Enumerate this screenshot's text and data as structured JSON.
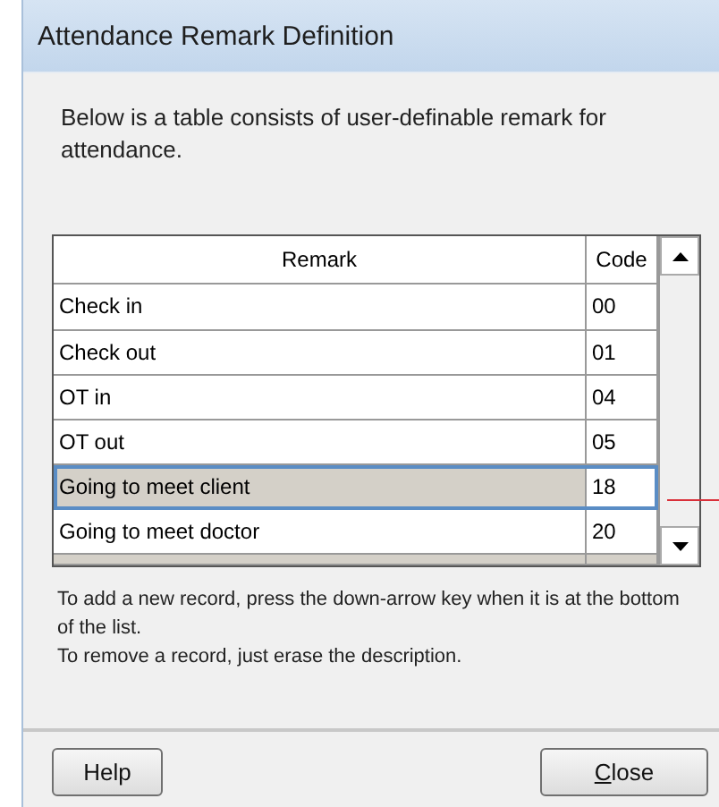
{
  "window": {
    "title": "Attendance Remark Definition"
  },
  "intro": "Below is a table consists of user-definable remark for attendance.",
  "table": {
    "columns": [
      "Remark",
      "Code"
    ],
    "rows": [
      {
        "remark": "Check in",
        "code": "00",
        "selected": false
      },
      {
        "remark": "Check out",
        "code": "01",
        "selected": false
      },
      {
        "remark": "OT in",
        "code": "04",
        "selected": false
      },
      {
        "remark": "OT out",
        "code": "05",
        "selected": false
      },
      {
        "remark": "Going to meet client",
        "code": "18",
        "selected": true
      },
      {
        "remark": "Going to meet doctor",
        "code": "20",
        "selected": false
      }
    ],
    "new_row": true,
    "leader_line": true
  },
  "help_text": [
    "To add a new record, press the down-arrow key when it is at the bottom of the list.",
    "To remove a record, just erase the description."
  ],
  "buttons": [
    {
      "label": "Help",
      "underline_first": false
    },
    {
      "label": "Close",
      "underline_first": true
    }
  ]
}
